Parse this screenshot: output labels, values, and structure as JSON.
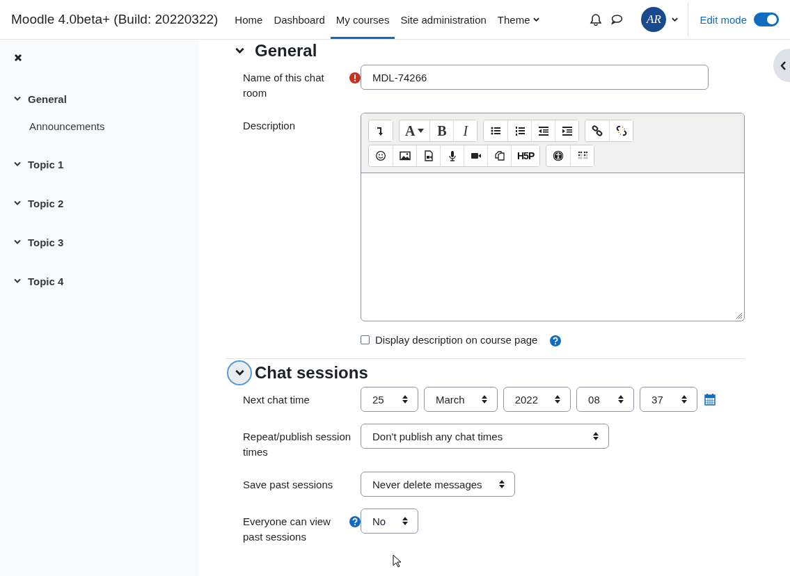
{
  "site_name": "Moodle 4.0beta+ (Build: 20220322)",
  "nav": [
    {
      "label": "Home",
      "selected": false,
      "dropdown": false
    },
    {
      "label": "Dashboard",
      "selected": false,
      "dropdown": false
    },
    {
      "label": "My courses",
      "selected": true,
      "dropdown": false
    },
    {
      "label": "Site administration",
      "selected": false,
      "dropdown": false
    },
    {
      "label": "Theme",
      "selected": false,
      "dropdown": true
    }
  ],
  "user": {
    "initials": "AR"
  },
  "edit_mode": {
    "label": "Edit mode",
    "on": true
  },
  "sidebar": {
    "items": [
      {
        "label": "General",
        "expanded": true,
        "children": [
          {
            "label": "Announcements"
          }
        ]
      },
      {
        "label": "Topic 1",
        "expanded": true
      },
      {
        "label": "Topic 2",
        "expanded": true
      },
      {
        "label": "Topic 3",
        "expanded": true
      },
      {
        "label": "Topic 4",
        "expanded": true
      }
    ]
  },
  "sections": [
    {
      "title": "General",
      "expanded": true,
      "focused": false,
      "fields": [
        {
          "kind": "text",
          "label": "Name of this chat room",
          "required": true,
          "value": "MDL-74266"
        },
        {
          "kind": "editor",
          "label": "Description",
          "toolbar": [
            [
              [
                {
                  "kind": "undo"
                }
              ],
              [
                {
                  "kind": "font",
                  "label": "A"
                },
                {
                  "kind": "bold",
                  "label": "B"
                },
                {
                  "kind": "italic",
                  "label": "I"
                }
              ],
              [
                {
                  "kind": "bullets"
                },
                {
                  "kind": "numbers"
                },
                {
                  "kind": "outdent"
                },
                {
                  "kind": "indent"
                }
              ],
              [
                {
                  "kind": "link"
                },
                {
                  "kind": "unlink"
                }
              ]
            ],
            [
              [
                {
                  "kind": "emoji"
                },
                {
                  "kind": "image"
                },
                {
                  "kind": "media"
                },
                {
                  "kind": "mic"
                },
                {
                  "kind": "video"
                },
                {
                  "kind": "files"
                },
                {
                  "kind": "h5p",
                  "label": "H5P"
                }
              ],
              [
                {
                  "kind": "access"
                },
                {
                  "kind": "braille"
                }
              ]
            ]
          ]
        },
        {
          "kind": "checkbox",
          "label": "Display description on course page",
          "checked": false,
          "help": true
        }
      ]
    },
    {
      "title": "Chat sessions",
      "expanded": true,
      "focused": true,
      "fields": [
        {
          "kind": "date",
          "label": "Next chat time",
          "parts": [
            "25",
            "March",
            "2022",
            "08",
            "37"
          ]
        },
        {
          "kind": "select",
          "label": "Repeat/publish session times",
          "value": "Don't publish any chat times"
        },
        {
          "kind": "select",
          "label": "Save past sessions",
          "value": "Never delete messages"
        },
        {
          "kind": "select",
          "label": "Everyone can view past sessions",
          "help": true,
          "value": "No"
        }
      ]
    }
  ]
}
